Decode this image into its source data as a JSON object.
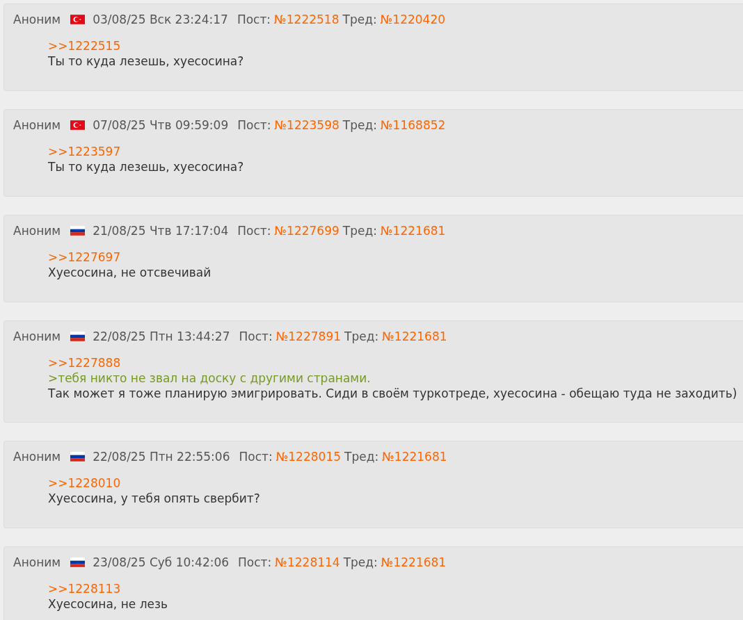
{
  "posts": [
    {
      "name": "Аноним",
      "flag": {
        "kind": "turkey"
      },
      "date": "03/08/25 Вск 23:24:17",
      "post_label": "Пост:",
      "post_number": "№1222518",
      "thread_label": "Тред:",
      "thread_number": "№1220420",
      "lines": [
        {
          "kind": "reply",
          "text": ">>1222515"
        },
        {
          "kind": "text",
          "text": "Ты то куда лезешь, хуесосина?"
        }
      ]
    },
    {
      "name": "Аноним",
      "flag": {
        "kind": "turkey"
      },
      "date": "07/08/25 Чтв 09:59:09",
      "post_label": "Пост:",
      "post_number": "№1223598",
      "thread_label": "Тред:",
      "thread_number": "№1168852",
      "lines": [
        {
          "kind": "reply",
          "text": ">>1223597"
        },
        {
          "kind": "text",
          "text": "Ты то куда лезешь, хуесосина?"
        }
      ]
    },
    {
      "name": "Аноним",
      "flag": {
        "kind": "russia"
      },
      "date": "21/08/25 Чтв 17:17:04",
      "post_label": "Пост:",
      "post_number": "№1227699",
      "thread_label": "Тред:",
      "thread_number": "№1221681",
      "lines": [
        {
          "kind": "reply",
          "text": ">>1227697"
        },
        {
          "kind": "text",
          "text": "Хуесосина, не отсвечивай"
        }
      ]
    },
    {
      "name": "Аноним",
      "flag": {
        "kind": "russia"
      },
      "date": "22/08/25 Птн 13:44:27",
      "post_label": "Пост:",
      "post_number": "№1227891",
      "thread_label": "Тред:",
      "thread_number": "№1221681",
      "lines": [
        {
          "kind": "reply",
          "text": ">>1227888"
        },
        {
          "kind": "quote",
          "text": ">тебя никто не звал на доску с другими странами."
        },
        {
          "kind": "text",
          "text": "Так может я тоже планирую эмигрировать. Сиди в своём туркотреде, хуесосина - обещаю туда не заходить)"
        }
      ]
    },
    {
      "name": "Аноним",
      "flag": {
        "kind": "russia"
      },
      "date": "22/08/25 Птн 22:55:06",
      "post_label": "Пост:",
      "post_number": "№1228015",
      "thread_label": "Тред:",
      "thread_number": "№1221681",
      "lines": [
        {
          "kind": "reply",
          "text": ">>1228010"
        },
        {
          "kind": "text",
          "text": "Хуесосина, у тебя опять свербит?"
        }
      ]
    },
    {
      "name": "Аноним",
      "flag": {
        "kind": "russia"
      },
      "date": "23/08/25 Суб 10:42:06",
      "post_label": "Пост:",
      "post_number": "№1228114",
      "thread_label": "Тред:",
      "thread_number": "№1221681",
      "lines": [
        {
          "kind": "reply",
          "text": ">>1228113"
        },
        {
          "kind": "text",
          "text": "Хуесосина, не лезь"
        }
      ]
    }
  ]
}
